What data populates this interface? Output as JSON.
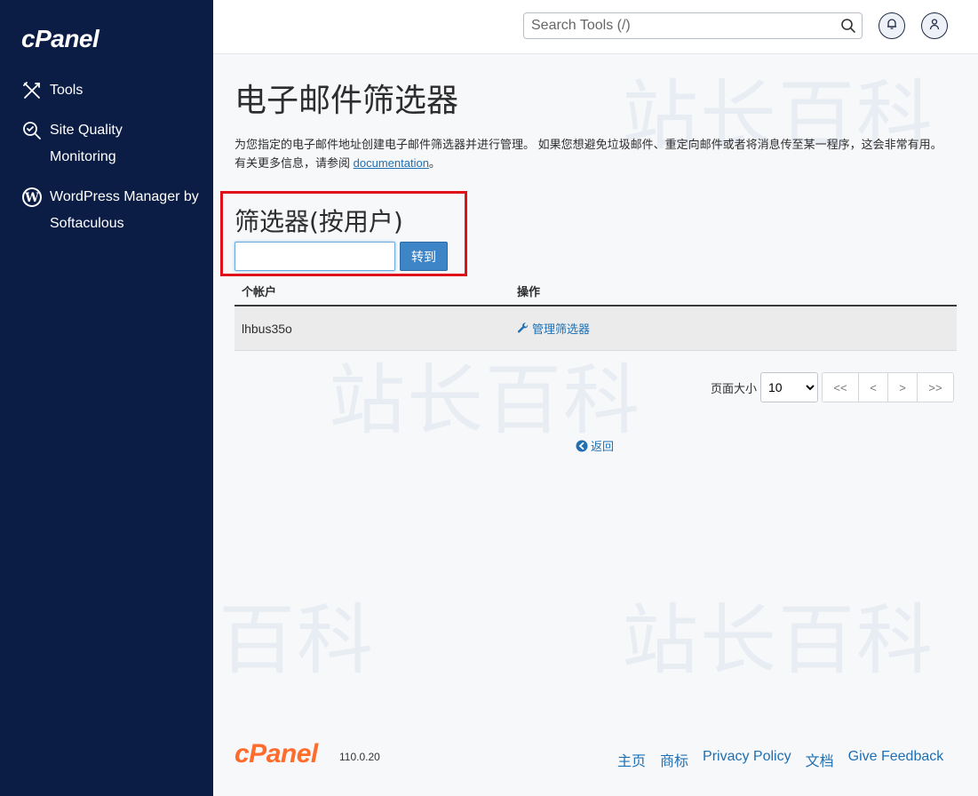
{
  "sidebar": {
    "logo": "cPanel",
    "items": [
      {
        "label": "Tools",
        "icon": "tools-icon"
      },
      {
        "label": "Site Quality Monitoring",
        "icon": "site-quality-icon"
      },
      {
        "label": "WordPress Manager by Softaculous",
        "icon": "wordpress-icon"
      }
    ]
  },
  "header": {
    "search_placeholder": "Search Tools (/)",
    "notifications_icon": "bell-icon",
    "user_icon": "user-icon"
  },
  "main": {
    "title": "电子邮件筛选器",
    "description": "为您指定的电子邮件地址创建电子邮件筛选器并进行管理。 如果您想避免垃圾邮件、重定向邮件或者将消息传至某一程序，这会非常有用。 有关更多信息，请参阅",
    "doc_link": "documentation",
    "doc_suffix": "。",
    "section_title": "筛选器(按用户)",
    "filter_input_value": "",
    "go_button": "转到",
    "table": {
      "headers": [
        "个帐户",
        "操作"
      ],
      "rows": [
        {
          "account": "lhbus35o",
          "action": "管理筛选器"
        }
      ]
    },
    "pagination": {
      "page_size_label": "页面大小",
      "page_size": "10",
      "page_size_options": [
        "10"
      ],
      "buttons": [
        "<<",
        "<",
        ">",
        ">>"
      ]
    },
    "back_link": "返回"
  },
  "footer": {
    "logo": "cPanel",
    "version": "110.0.20",
    "links": [
      "主页",
      "商标",
      "Privacy Policy",
      "文档",
      "Give Feedback"
    ]
  },
  "watermark": "站长百科",
  "colors": {
    "sidebar_bg": "#0b1d45",
    "accent": "#3e85c7",
    "link": "#1f6fb2",
    "footer_logo": "#ff6c2c",
    "highlight": "#e0101a"
  }
}
